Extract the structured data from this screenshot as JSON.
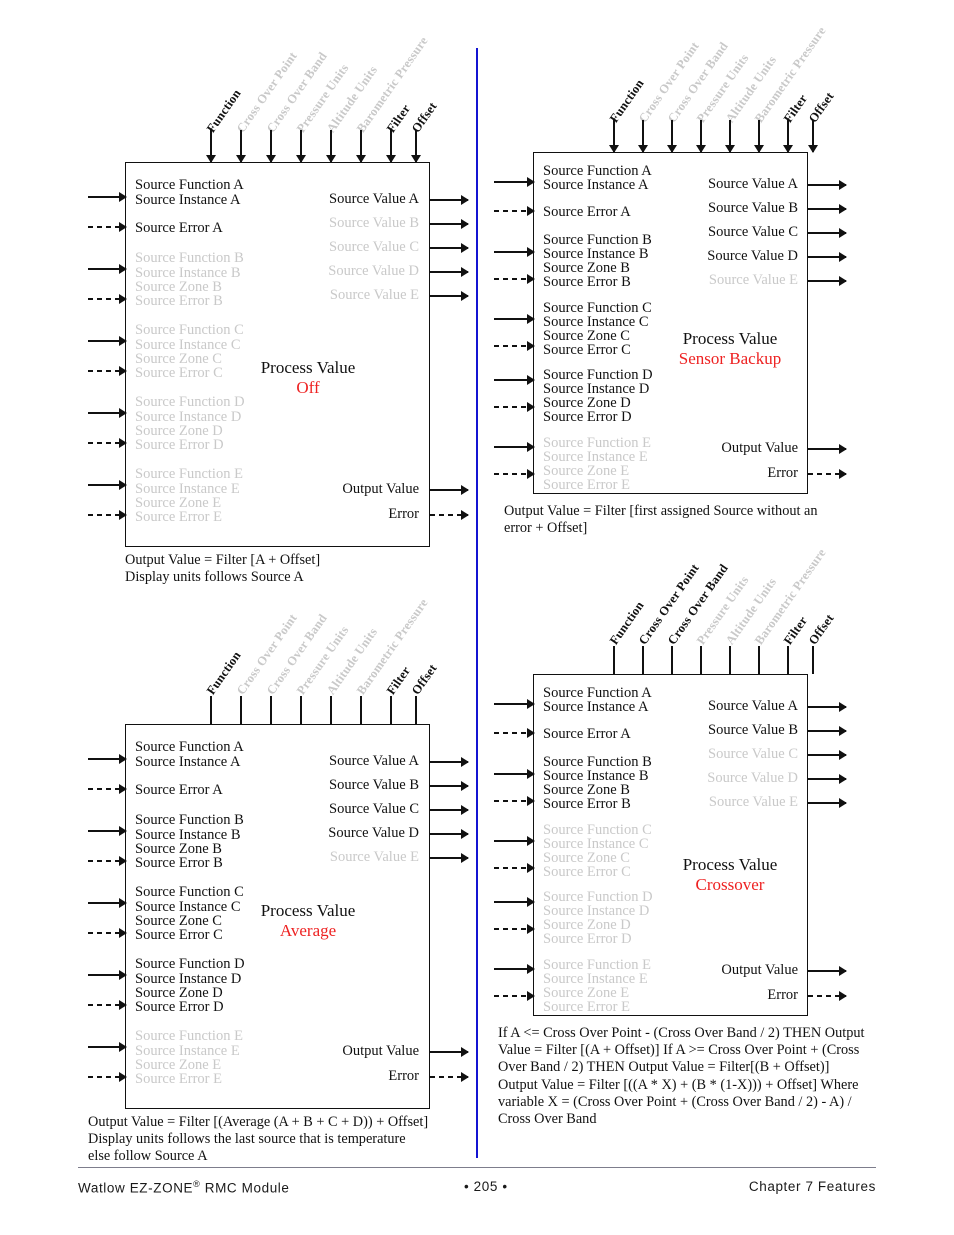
{
  "footer": {
    "left_prefix": "Watlow EZ-ZONE",
    "left_sup": "®",
    "left_suffix": " RMC Module",
    "page_marker": "•  205  •",
    "right": "Chapter 7 Features"
  },
  "common": {
    "title": "Process Value",
    "param_labels": [
      "Function",
      "Cross Over Point",
      "Cross Over Band",
      "Pressure Units",
      "Altitude Units",
      "Barometric Pressure",
      "Filter",
      "Offset"
    ],
    "left_labels_A": [
      "Source Function A",
      "Source Instance A",
      "Source Error A"
    ],
    "left_group_B": [
      "Source Function B",
      "Source Instance B",
      "Source Zone B",
      "Source Error B"
    ],
    "left_group_C": [
      "Source Function C",
      "Source Instance C",
      "Source Zone C",
      "Source Error C"
    ],
    "left_group_D": [
      "Source Function D",
      "Source Instance D",
      "Source Zone D",
      "Source Error D"
    ],
    "left_group_E": [
      "Source Function E",
      "Source Instance E",
      "Source Zone E",
      "Source Error E"
    ],
    "source_values": [
      "Source Value A",
      "Source Value B",
      "Source Value C",
      "Source Value D",
      "Source Value E"
    ],
    "output_value": "Output Value",
    "error": "Error",
    "colors": {
      "accent_red": "#ee2222",
      "dim_grey": "#c9c9c9",
      "divider_blue": "#1414d2",
      "ink": "#111111"
    }
  },
  "diagrams": [
    {
      "id": "off",
      "mode": "Off",
      "param_active": [
        true,
        false,
        false,
        false,
        false,
        false,
        true,
        true
      ],
      "top_connector": "arrow",
      "left_active": {
        "A": true,
        "B": false,
        "C": false,
        "D": false,
        "E": false
      },
      "value_active": [
        true,
        false,
        false,
        false,
        false
      ],
      "caption_lines": [
        "Output Value = Filter [A + Offset]",
        "Display units follows Source A"
      ]
    },
    {
      "id": "sensor-backup",
      "mode": "Sensor Backup",
      "param_active": [
        true,
        false,
        false,
        false,
        false,
        false,
        true,
        true
      ],
      "top_connector": "arrow",
      "left_active": {
        "A": true,
        "B": true,
        "C": true,
        "D": true,
        "E": false
      },
      "value_active": [
        true,
        true,
        true,
        true,
        false
      ],
      "caption_lines": [
        "Output Value = Filter [first assigned Source without an",
        "error + Offset]"
      ]
    },
    {
      "id": "average",
      "mode": "Average",
      "param_active": [
        true,
        false,
        false,
        false,
        false,
        false,
        true,
        true
      ],
      "top_connector": "tick",
      "left_active": {
        "A": true,
        "B": true,
        "C": true,
        "D": true,
        "E": false
      },
      "value_active": [
        true,
        true,
        true,
        true,
        false
      ],
      "caption_lines": [
        "Output Value = Filter [(Average (A + B + C + D)) + Offset]",
        "Display units follows the last source that is temperature",
        "else follow Source A"
      ]
    },
    {
      "id": "crossover",
      "mode": "Crossover",
      "param_active": [
        true,
        true,
        true,
        false,
        false,
        false,
        true,
        true
      ],
      "top_connector": "tick",
      "left_active": {
        "A": true,
        "B": true,
        "C": false,
        "D": false,
        "E": false
      },
      "value_active": [
        true,
        true,
        false,
        false,
        false
      ],
      "caption_lines": [
        "If A <= Cross Over Point - (Cross Over Band / 2) THEN Output",
        "Value = Filter [(A + Offset)] If A >= Cross Over Point + (Cross",
        "Over Band / 2) THEN Output Value = Filter[(B + Offset)]",
        "Output Value = Filter [((A * X) + (B * (1-X))) + Offset] Where",
        "variable X = (Cross Over Point + (Cross Over Band / 2) - A) /",
        "Cross Over Band"
      ]
    }
  ]
}
